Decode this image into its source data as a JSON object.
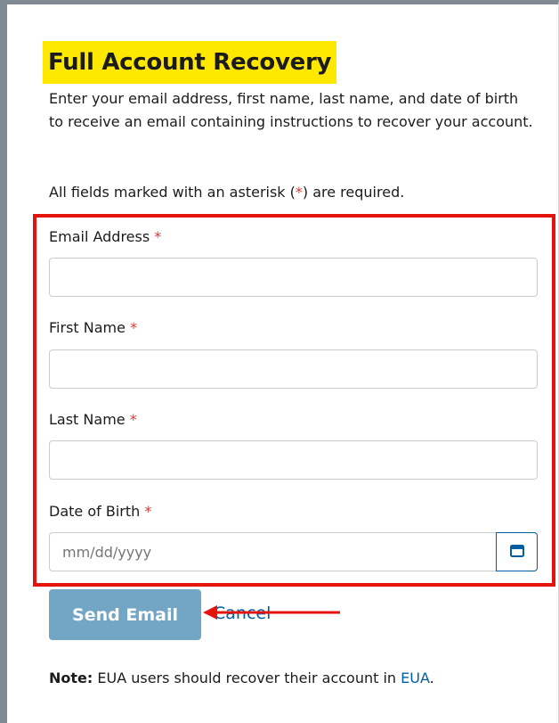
{
  "page": {
    "title": "Full Account Recovery",
    "intro": "Enter your email address, first name, last name, and date of birth to receive an email containing instructions to recover your account.",
    "required_prefix": "All fields marked with an asterisk (",
    "required_star": "*",
    "required_suffix": ") are required."
  },
  "form": {
    "email": {
      "label": "Email Address",
      "required_mark": "*",
      "value": ""
    },
    "first_name": {
      "label": "First Name",
      "required_mark": "*",
      "value": ""
    },
    "last_name": {
      "label": "Last Name",
      "required_mark": "*",
      "value": ""
    },
    "dob": {
      "label": "Date of Birth",
      "required_mark": "*",
      "placeholder": "mm/dd/yyyy",
      "value": "",
      "picker_icon": "calendar-icon"
    }
  },
  "actions": {
    "send_label": "Send Email",
    "cancel_label": "Cancel"
  },
  "note": {
    "prefix": "Note:",
    "text": " EUA users should recover their account in ",
    "link": "EUA",
    "suffix": "."
  },
  "colors": {
    "title_highlight": "#ffe800",
    "annotation_red": "#e3130e",
    "link_blue": "#005ea2",
    "send_button": "#73a6c4",
    "required_red": "#d83933"
  }
}
